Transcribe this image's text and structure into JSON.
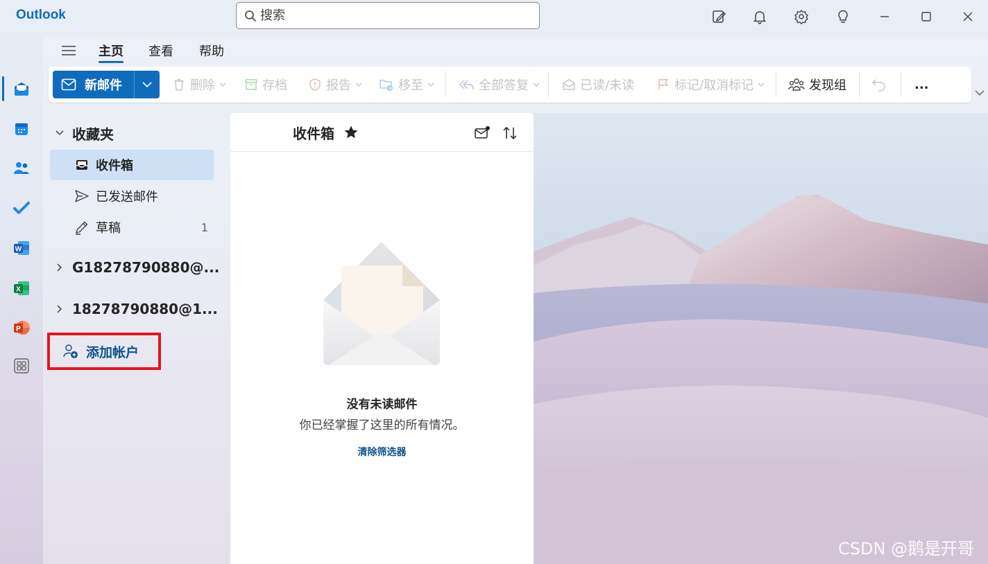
{
  "app": {
    "title": "Outlook"
  },
  "search": {
    "placeholder": "搜索",
    "value": ""
  },
  "titlebar_icons": [
    "compose-note-icon",
    "bell-icon",
    "gear-icon",
    "lightbulb-icon",
    "minimize-icon",
    "maximize-icon",
    "close-icon"
  ],
  "rail": {
    "items": [
      {
        "name": "mail",
        "icon": "mail-icon",
        "active": true
      },
      {
        "name": "calendar",
        "icon": "calendar-icon"
      },
      {
        "name": "people",
        "icon": "people-icon"
      },
      {
        "name": "todo",
        "icon": "checkmark-icon"
      },
      {
        "name": "word",
        "icon": "word-icon",
        "letter": "W"
      },
      {
        "name": "excel",
        "icon": "excel-icon",
        "letter": "X"
      },
      {
        "name": "powerpoint",
        "icon": "powerpoint-icon",
        "letter": "P"
      },
      {
        "name": "apps",
        "icon": "apps-icon"
      }
    ]
  },
  "tabs": [
    {
      "label": "主页",
      "active": true
    },
    {
      "label": "查看"
    },
    {
      "label": "帮助"
    }
  ],
  "ribbon": {
    "new_mail": "新邮件",
    "delete": "删除",
    "archive": "存档",
    "report": "报告",
    "move": "移至",
    "reply_all": "全部答复",
    "read_unread": "已读/未读",
    "flag": "标记/取消标记",
    "discover_groups": "发现组",
    "more": "..."
  },
  "folders": {
    "favorites_label": "收藏夹",
    "items": [
      {
        "label": "收件箱",
        "selected": true,
        "icon": "inbox-icon"
      },
      {
        "label": "已发送邮件",
        "icon": "send-icon"
      },
      {
        "label": "草稿",
        "icon": "draft-icon",
        "count": "1"
      }
    ],
    "accounts": [
      {
        "label": "G18278790880@..."
      },
      {
        "label": "18278790880@1..."
      }
    ],
    "add_account": "添加帐户"
  },
  "message_list": {
    "title": "收件箱",
    "empty_title": "没有未读邮件",
    "empty_subtitle": "你已经掌握了这里的所有情况。",
    "clear_filter": "清除筛选器"
  },
  "watermark": "CSDN @鹅是开哥",
  "colors": {
    "accent": "#0f6cbd",
    "highlight_border": "#e8141c",
    "selected_bg": "#cfe0f5"
  }
}
